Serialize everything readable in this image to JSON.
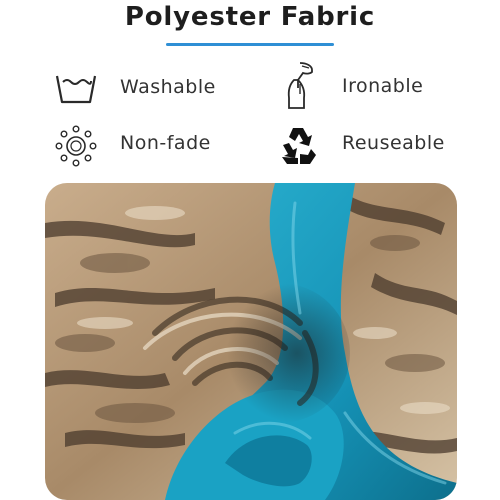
{
  "header": {
    "title": "Polyester Fabric"
  },
  "features": {
    "washable": {
      "label": "Washable",
      "icon": "wash-tub-icon"
    },
    "ironable": {
      "label": "Ironable",
      "icon": "garment-steamer-icon"
    },
    "nonfade": {
      "label": "Non-fade",
      "icon": "sun-non-fade-icon"
    },
    "reuseable": {
      "label": "Reuseable",
      "icon": "recycle-icon"
    }
  },
  "colors": {
    "accent_underline": "#2f8fd5",
    "fabric_teal": "#1c9bbf",
    "fabric_bark": "#b89c7c",
    "text": "#333333"
  },
  "image": {
    "subject": "fabric-swirl-photo"
  }
}
